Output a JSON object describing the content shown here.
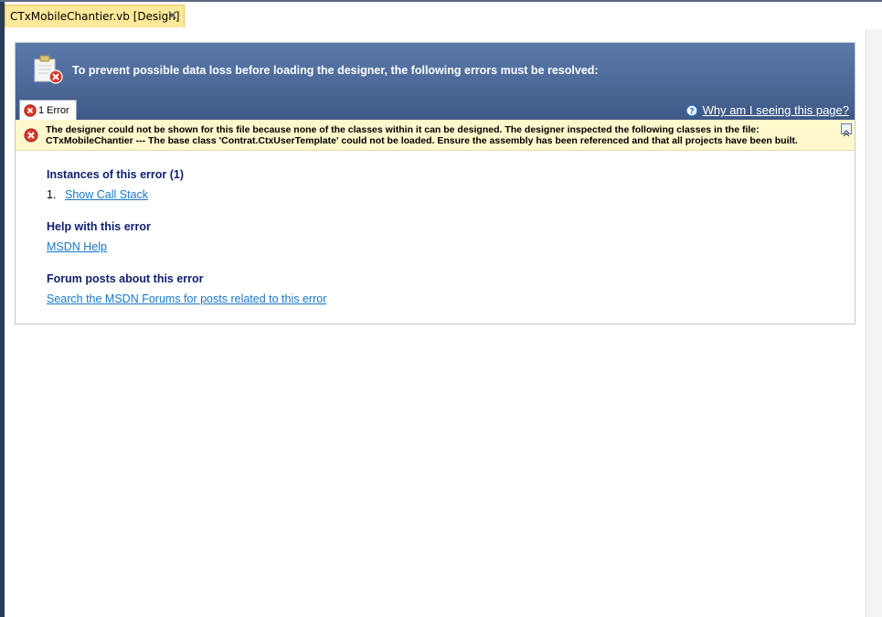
{
  "tab": {
    "title": "CTxMobileChantier.vb [Design]",
    "close_glyph": "✕"
  },
  "header": {
    "message": "To prevent possible data loss before loading the designer, the following errors must be resolved:",
    "error_tab_label": "1 Error",
    "why_link": "Why am I seeing this page?"
  },
  "error": {
    "message": "The designer could not be shown for this file because none of the classes within it can be designed. The designer inspected the following classes in the file: CTxMobileChantier --- The base class 'Contrat.CtxUserTemplate' could not be loaded. Ensure the assembly has been referenced and that all projects have been built."
  },
  "sections": {
    "instances_title": "Instances of this error (1)",
    "instance_number": "1.",
    "show_call_stack": "Show Call Stack",
    "help_title": "Help with this error",
    "msdn_help": "MSDN Help",
    "forum_title": "Forum posts about this error",
    "forum_link": "Search the MSDN Forums for posts related to this error"
  },
  "colors": {
    "header": "#4f6d9c",
    "error_bar": "#fff8cc",
    "section_title": "#0f1f6e",
    "link": "#1877c9",
    "tab_active": "#fde99a"
  },
  "icons": [
    "document-error-icon",
    "error-icon",
    "help-icon",
    "collapse-icon",
    "close-icon"
  ]
}
